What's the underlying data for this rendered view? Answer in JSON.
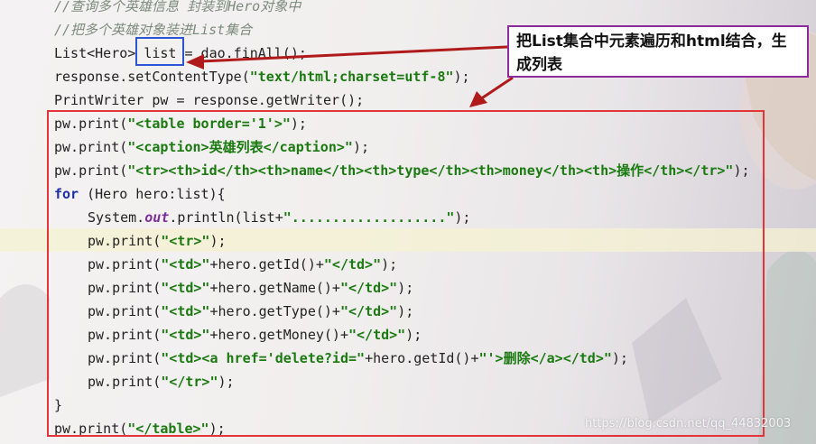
{
  "code": {
    "line1": "//查询多个英雄信息 封装到Hero对象中",
    "line2": "//把多个英雄对象装进List集合",
    "line3_a": "List<Hero> ",
    "line3_b": "list",
    "line3_c": " = dao.finAll();",
    "line4_a": "response.setContentType(",
    "line4_b": "\"text/html;charset=utf-8\"",
    "line4_c": ");",
    "line5": "PrintWriter pw = response.getWriter();",
    "line6_a": "pw.print(",
    "line6_b": "\"<table border='1'>\"",
    "line6_c": ");",
    "line7_a": "pw.print(",
    "line7_b": "\"<caption>英雄列表</caption>\"",
    "line7_c": ");",
    "line8_a": "pw.print(",
    "line8_b": "\"<tr><th>id</th><th>name</th><th>type</th><th>money</th><th>操作</th></tr>\"",
    "line8_c": ");",
    "line9_kw": "for",
    "line9_rest": " (Hero hero:list){",
    "line10_a": "System.",
    "line10_b": "out",
    "line10_c": ".println(list+",
    "line10_d": "\"...................\"",
    "line10_e": ");",
    "line11_a": "pw.print(",
    "line11_b": "\"<tr>\"",
    "line11_c": ");",
    "line12_a": "pw.print(",
    "line12_b": "\"<td>\"",
    "line12_c": "+hero.getId()+",
    "line12_d": "\"</td>\"",
    "line12_e": ");",
    "line13_a": "pw.print(",
    "line13_b": "\"<td>\"",
    "line13_c": "+hero.getName()+",
    "line13_d": "\"</td>\"",
    "line13_e": ");",
    "line14_a": "pw.print(",
    "line14_b": "\"<td>\"",
    "line14_c": "+hero.getType()+",
    "line14_d": "\"</td>\"",
    "line14_e": ");",
    "line15_a": "pw.print(",
    "line15_b": "\"<td>\"",
    "line15_c": "+hero.getMoney()+",
    "line15_d": "\"</td>\"",
    "line15_e": ");",
    "line16_a": "pw.print(",
    "line16_b": "\"<td><a href='delete?id=\"",
    "line16_c": "+hero.getId()+",
    "line16_d": "\"'>删除</a></td>\"",
    "line16_e": ");",
    "line17_a": "pw.print(",
    "line17_b": "\"</tr>\"",
    "line17_c": ");",
    "line18": "}",
    "line19_a": "pw.print(",
    "line19_b": "\"</table>\"",
    "line19_c": ");"
  },
  "annotation": {
    "callout_text": "把List集合中元素遍历和html结合，生成列表"
  },
  "watermark": "https://blog.csdn.net/qq_44832003",
  "colors": {
    "red_box": "#e3343a",
    "blue_box": "#2a55d6",
    "callout_border": "#8e2b9c",
    "arrow": "#b01a1a"
  }
}
